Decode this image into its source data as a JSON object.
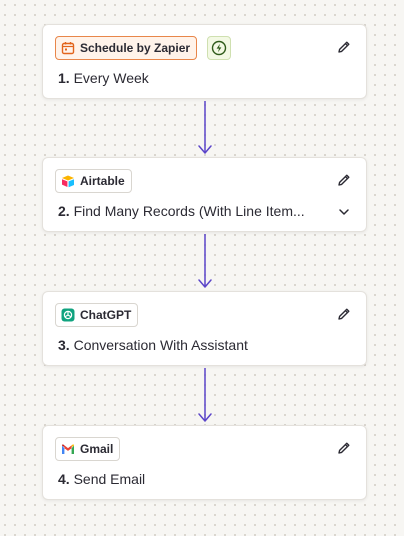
{
  "steps": [
    {
      "app_label": "Schedule by Zapier",
      "app_icon": "calendar-icon",
      "number": "1.",
      "title": "Every Week",
      "is_trigger": true,
      "extra_icon": "bolt-icon"
    },
    {
      "app_label": "Airtable",
      "app_icon": "airtable-icon",
      "number": "2.",
      "title": "Find Many Records (With Line Item...",
      "has_expand": true,
      "expand_icon": "chevron-down-icon"
    },
    {
      "app_label": "ChatGPT",
      "app_icon": "chatgpt-icon",
      "number": "3.",
      "title": "Conversation With Assistant"
    },
    {
      "app_label": "Gmail",
      "app_icon": "gmail-icon",
      "number": "4.",
      "title": "Send Email"
    }
  ],
  "edit_icon": "pencil-icon",
  "connector_icon": "arrow-down-icon",
  "colors": {
    "trigger_accent": "#e8864a",
    "connector": "#5b45c9",
    "bolt": "#2f5b1a",
    "text": "#2b2a33"
  }
}
